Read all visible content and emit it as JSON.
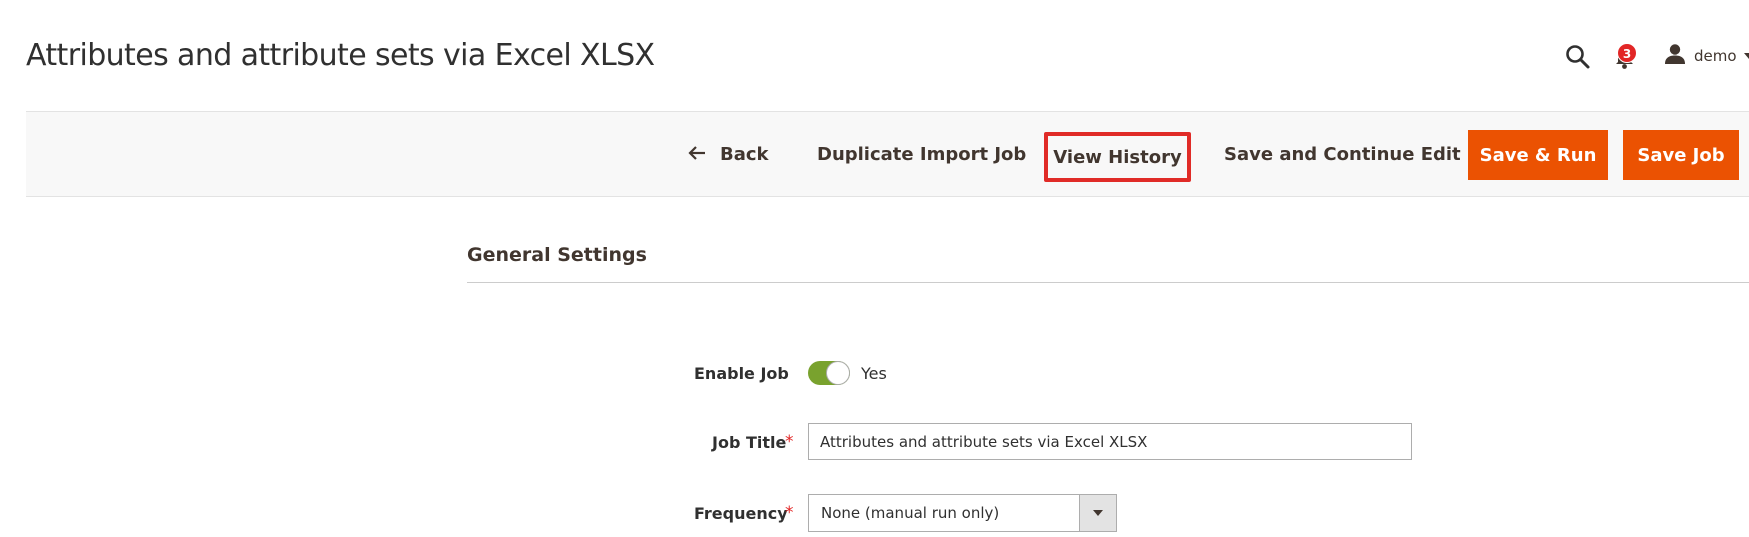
{
  "page": {
    "title": "Attributes and attribute sets via Excel XLSX"
  },
  "header": {
    "notifications_count": "3",
    "user_name": "demo",
    "icons": {
      "search": "search-icon",
      "notifications": "bell-icon",
      "user": "user-icon",
      "menu": "caret-down-icon"
    }
  },
  "toolbar": {
    "back_label": "Back",
    "duplicate_label": "Duplicate Import Job",
    "view_history_label": "View History",
    "save_continue_label": "Save and Continue Edit",
    "save_run_label": "Save & Run",
    "save_job_label": "Save Job"
  },
  "form": {
    "section_title": "General Settings",
    "enable_job": {
      "label": "Enable Job",
      "value": "Yes",
      "enabled": true
    },
    "job_title": {
      "label": "Job Title",
      "value": "Attributes and attribute sets via Excel XLSX",
      "required_mark": "*"
    },
    "frequency": {
      "label": "Frequency",
      "value": "None (manual run only)",
      "required_mark": "*"
    }
  },
  "colors": {
    "primary": "#eb5202",
    "highlight": "#e02b27",
    "toggle_on": "#79a22e",
    "badge": "#e22626",
    "toolbar_bg": "#f8f8f8"
  }
}
